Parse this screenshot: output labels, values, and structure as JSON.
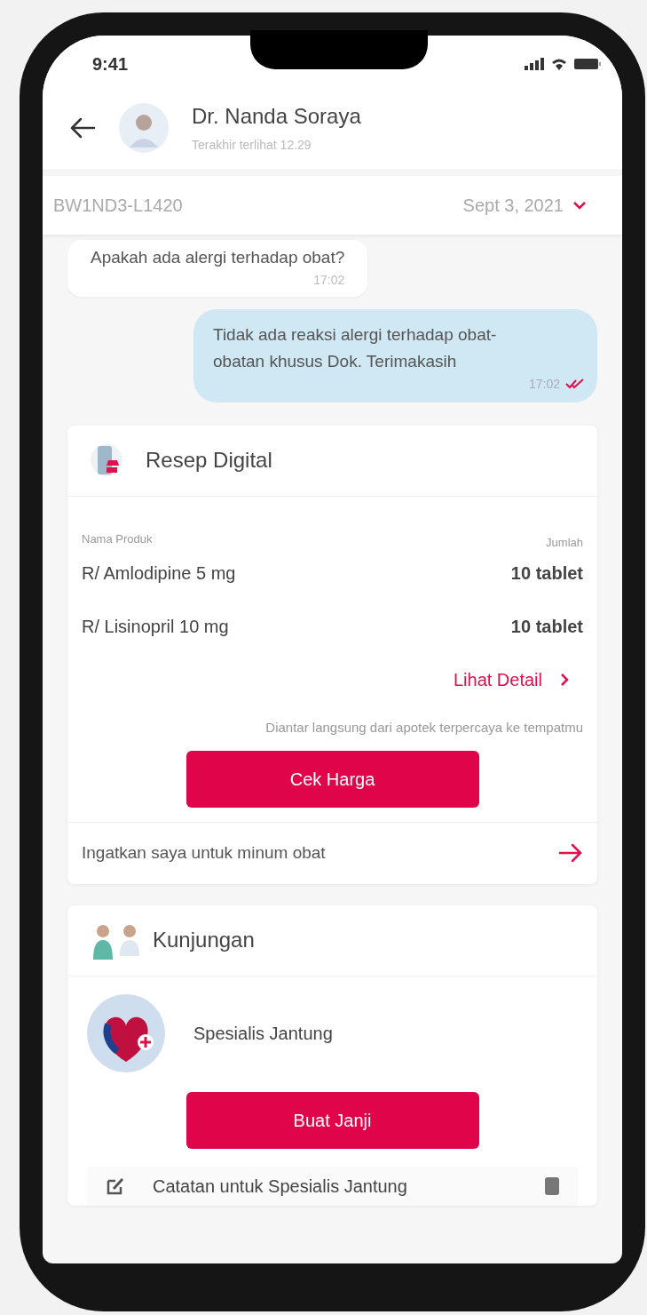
{
  "status_bar": {
    "time": "9:41"
  },
  "header": {
    "name": "Dr. Nanda Soraya",
    "subtitle": "Terakhir terlihat 12.29"
  },
  "order_bar": {
    "id": "BW1ND3-L1420",
    "date": "Sept 3, 2021"
  },
  "messages": [
    {
      "kind": "received",
      "text": "Apakah ada alergi terhadap obat?",
      "time": "17:02"
    },
    {
      "kind": "sent",
      "text": "Tidak ada reaksi alergi terhadap obat-obatan khusus Dok. Terimakasih",
      "time": "17:02",
      "read": true
    }
  ],
  "prescription": {
    "title": "Resep Digital",
    "columns": [
      "Nama Produk",
      "Jumlah"
    ],
    "items": [
      {
        "name": "R/ Amlodipine 5 mg",
        "qty": "10 tablet"
      },
      {
        "name": "R/ Lisinopril 10 mg",
        "qty": "10 tablet"
      }
    ],
    "detail_link": "Lihat Detail",
    "note": "Diantar langsung dari apotek terpercaya ke tempatmu",
    "button": "Cek Harga",
    "reminder": "Ingatkan saya untuk minum obat"
  },
  "visit": {
    "title": "Kunjungan",
    "specialist": "Spesialis Jantung",
    "button": "Buat Janji",
    "note": "Catatan untuk Spesialis Jantung"
  }
}
